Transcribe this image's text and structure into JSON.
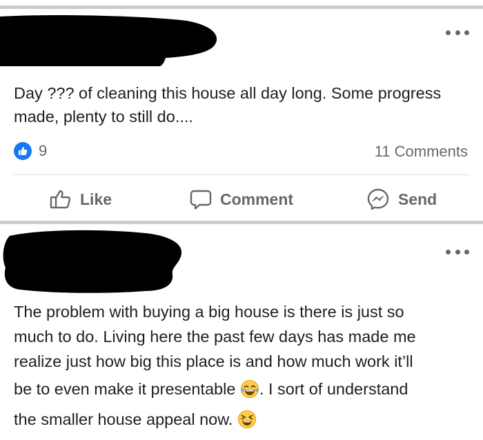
{
  "post1": {
    "text": "Day ??? of cleaning this house all day long. Some progress made, plenty to still do....",
    "like_count": "9",
    "comments_label": "11 Comments",
    "actions": {
      "like": "Like",
      "comment": "Comment",
      "send": "Send"
    }
  },
  "post2": {
    "lines": [
      "The problem with buying a big house is there is just so",
      "much to do. Living here the past few days has made me",
      "realize just how big this place is and how much work it’ll",
      "be to even make it presentable",
      ". I sort of understand",
      "the smaller house appeal now."
    ]
  },
  "icons": {
    "more": "more-horizontal-icon",
    "like_reaction": "thumbs-up-icon",
    "like": "thumbs-up-outline-icon",
    "comment": "speech-bubble-icon",
    "send": "messenger-icon",
    "emoji1": "tears-of-joy-emoji",
    "emoji2": "grinning-squinting-emoji"
  },
  "colors": {
    "brand": "#1877f2",
    "secondary_text": "#65676b",
    "separator": "#c9ccd1"
  }
}
